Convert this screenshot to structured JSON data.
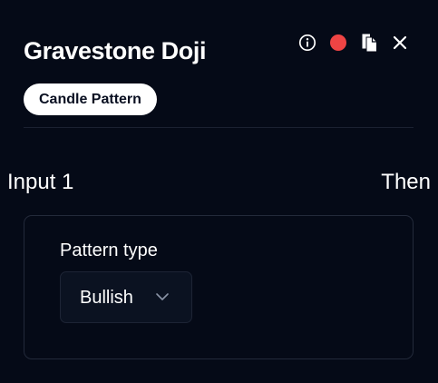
{
  "header": {
    "title": "Gravestone Doji",
    "badge": "Candle Pattern",
    "icons": [
      "info-icon",
      "status-dot",
      "copy-icon",
      "close-icon"
    ],
    "status_color": "#ef4444"
  },
  "flow": {
    "input_label": "Input 1",
    "output_label": "Then"
  },
  "pattern": {
    "field_label": "Pattern type",
    "selected": "Bullish"
  }
}
